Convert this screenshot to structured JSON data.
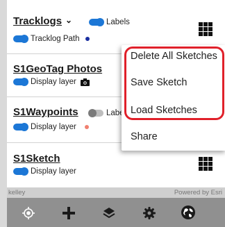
{
  "layers": [
    {
      "title": "Tracklogs",
      "labels_toggle": "Labels",
      "sublabel": "Tracklog Path",
      "dot_color": "#1a2fa0"
    },
    {
      "title": "S1GeoTag Photos",
      "sublabel": "Display layer"
    },
    {
      "title": "S1Waypoints",
      "labels_toggle": "Labe",
      "sublabel": "Display layer",
      "dot_color": "#f08070"
    },
    {
      "title": "S1Sketch",
      "sublabel": "Display layer"
    }
  ],
  "menu": {
    "items": [
      "Delete All Sketches",
      "Save Sketch",
      "Load Sketches",
      "Share"
    ]
  },
  "credits": {
    "left": "kelley",
    "right": "Powered by Esri"
  },
  "bottom_bar": {
    "icons": [
      "locate-icon",
      "add-icon",
      "layers-icon",
      "settings-icon",
      "globe-icon"
    ]
  },
  "colors": {
    "toggle_on": "#1c77d6",
    "highlight": "#e0202a"
  }
}
